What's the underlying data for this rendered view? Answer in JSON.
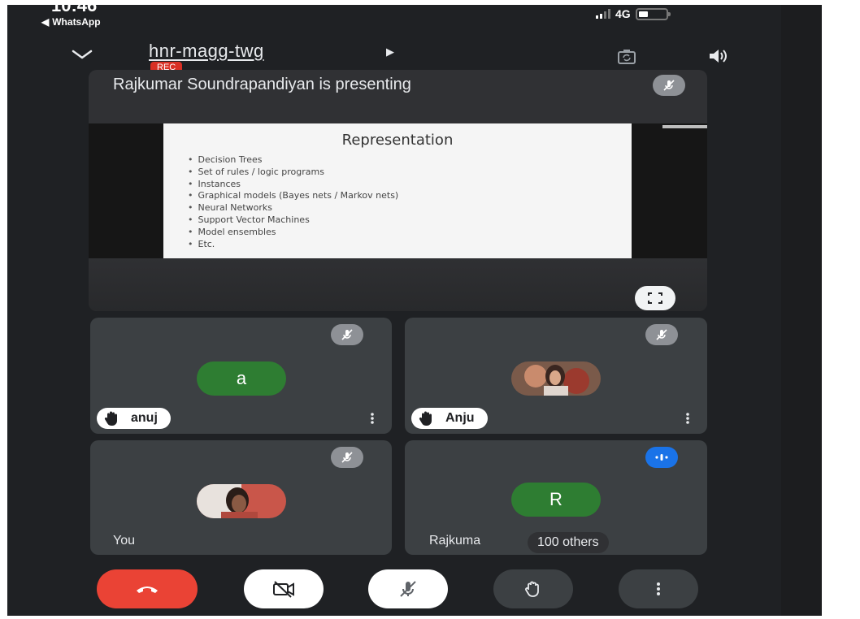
{
  "status_bar": {
    "time": "10:46",
    "back_app": "WhatsApp",
    "network": "4G"
  },
  "header": {
    "meeting_code": "hnr-magg-twg",
    "rec_badge": "REC"
  },
  "presentation": {
    "presenter_text": "Rajkumar Soundrapandiyan is presenting",
    "slide_title": "Representation",
    "slide_bullets": [
      "Decision Trees",
      "Set of rules / logic programs",
      "Instances",
      "Graphical models (Bayes nets / Markov nets)",
      "Neural Networks",
      "Support Vector Machines",
      "Model ensembles",
      "Etc."
    ]
  },
  "participants": [
    {
      "name": "anuj",
      "avatar_letter": "a",
      "hand_raised": true,
      "muted": true
    },
    {
      "name": "Anju",
      "hand_raised": true,
      "muted": true
    },
    {
      "name": "You",
      "muted": true
    },
    {
      "name": "Rajkuma",
      "avatar_letter": "R",
      "muted": false,
      "speaking": true,
      "others_label": "100 others"
    }
  ],
  "colors": {
    "end_call": "#ea4335",
    "avatar_green": "#2e7d32",
    "rec_red": "#d93025",
    "speaking_blue": "#1a73e8"
  },
  "icons": [
    "chevron-down-icon",
    "switch-camera-icon",
    "speaker-icon",
    "mic-off-icon",
    "fullscreen-icon",
    "raise-hand-icon",
    "more-vert-icon",
    "end-call-icon",
    "camera-off-icon"
  ]
}
